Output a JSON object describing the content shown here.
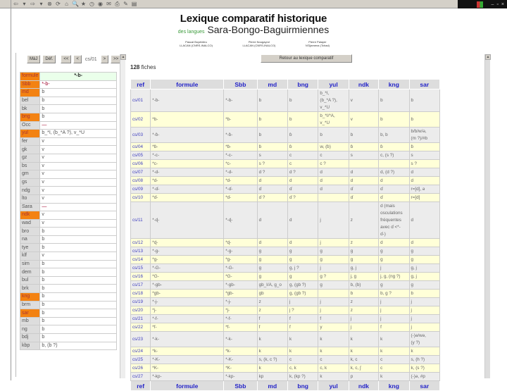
{
  "toolbar": {
    "icons": [
      "back-icon",
      "forward-icon",
      "stop-icon",
      "refresh-icon",
      "home-icon",
      "search-icon",
      "favorites-icon",
      "history-icon",
      "media-icon",
      "mail-icon",
      "print-icon",
      "edit-icon",
      "discuss-icon"
    ],
    "glyphs": [
      "⇦",
      "▾",
      "⇨",
      "▾",
      "⊗",
      "⟳",
      "⌂",
      "🔍",
      "★",
      "◷",
      "◉",
      "✉",
      "⎙",
      "✎",
      "▤"
    ]
  },
  "window": {
    "minimize": "–",
    "restore": "▫",
    "close": "×"
  },
  "header": {
    "title": "Lexique comparatif historique",
    "subtitle_small": "des langues",
    "subtitle": "Sara-Bongo-Baguirmiennes",
    "authors": [
      {
        "name": "Pascal Boyeldieu",
        "affil": "LLACAN (CNRS-INALCO)"
      },
      {
        "name": "Pierre Nougayrol",
        "affil": "LLACAN (CNRS-INALCO)"
      },
      {
        "name": "Pierre Palayer",
        "affil": "N'Djamena (Tchad)"
      }
    ]
  },
  "nav": {
    "maj": "MàJ",
    "def": "Déf.",
    "first": "<<",
    "prev": "<",
    "current": "cs/01",
    "next": ">",
    "last": ">>"
  },
  "detail": [
    {
      "k": "formule",
      "v": "*-b-",
      "hl": true
    },
    {
      "k": "Sbb",
      "v": "*-b-",
      "hl": true
    },
    {
      "k": "md",
      "v": "b",
      "hl": true
    },
    {
      "k": "bel",
      "v": "b"
    },
    {
      "k": "bk",
      "v": "b"
    },
    {
      "k": "bng",
      "v": "b",
      "hl": true
    },
    {
      "k": "Occ",
      "v": "—"
    },
    {
      "k": "yul",
      "v": "b_*I, (b_*A ?), v_*U",
      "hl": true
    },
    {
      "k": "fer",
      "v": "v"
    },
    {
      "k": "gk",
      "v": "v"
    },
    {
      "k": "gz",
      "v": "v"
    },
    {
      "k": "bs",
      "v": "v"
    },
    {
      "k": "gm",
      "v": "v"
    },
    {
      "k": "gs",
      "v": "v"
    },
    {
      "k": "ndg",
      "v": "v"
    },
    {
      "k": "lto",
      "v": "v"
    },
    {
      "k": "Sara",
      "v": "—"
    },
    {
      "k": "ndk",
      "v": "v",
      "hl": true
    },
    {
      "k": "wad",
      "v": "v"
    },
    {
      "k": "bro",
      "v": "b"
    },
    {
      "k": "na",
      "v": "b"
    },
    {
      "k": "tye",
      "v": "b"
    },
    {
      "k": "klf",
      "v": "v"
    },
    {
      "k": "sim",
      "v": "b"
    },
    {
      "k": "dem",
      "v": "b"
    },
    {
      "k": "bul",
      "v": "b"
    },
    {
      "k": "brk",
      "v": "b"
    },
    {
      "k": "kng",
      "v": "b",
      "hl": true
    },
    {
      "k": "brm",
      "v": "b"
    },
    {
      "k": "sar",
      "v": "b",
      "hl": true
    },
    {
      "k": "mb",
      "v": "b"
    },
    {
      "k": "ng",
      "v": "b"
    },
    {
      "k": "bdj",
      "v": "b"
    },
    {
      "k": "kbp",
      "v": "b, (b ?)"
    }
  ],
  "main": {
    "back_button": "Retour au lexique comparatif",
    "count": "128",
    "count_label": " fiches",
    "columns": [
      "ref",
      "formule",
      "Sbb",
      "md",
      "bng",
      "yul",
      "ndk",
      "kng",
      "sar"
    ],
    "rows": [
      [
        "cs/01",
        "*-b-",
        "*-b-",
        "b",
        "b",
        "b_*I,\n(b_*A ?),\nv_*U",
        "v",
        "b",
        "b"
      ],
      [
        "cs/02",
        "*b-",
        "*b-",
        "b",
        "b",
        "b_*I/*A,\nv_*U",
        "v",
        "b",
        "b"
      ],
      [
        "cs/03",
        "*-ɓ-",
        "*-ɓ-",
        "b",
        "ɓ",
        "b",
        "b",
        "b, b",
        "b/b/w/ə,\n(m ?)/#b"
      ],
      [
        "cs/04",
        "*ɓ-",
        "*ɓ-",
        "ɓ",
        "ɓ",
        "w, (ɓ)",
        "ɓ",
        "ɓ",
        "ɓ"
      ],
      [
        "cs/05",
        "*-c-",
        "*-c-",
        "s",
        "c",
        "c",
        "s",
        "c, (s ?)",
        "s"
      ],
      [
        "cs/06",
        "*c-",
        "*c-",
        "s ?",
        "c",
        "c ?",
        "",
        "",
        "s ?"
      ],
      [
        "cs/07",
        "*-d-",
        "*-d-",
        "d ?",
        "d ?",
        "d",
        "d",
        "d, (d ?)",
        "d"
      ],
      [
        "cs/08",
        "*d-",
        "*d-",
        "d",
        "d",
        "d",
        "d",
        "d",
        "d"
      ],
      [
        "cs/09",
        "*-ɗ-",
        "*-ɗ-",
        "ɗ",
        "ɗ",
        "d",
        "ɗ",
        "ɗ",
        "r=[d], ə"
      ],
      [
        "cs/10",
        "*ɗ-",
        "*ɗ-",
        "ɗ ?",
        "ɗ ?",
        "",
        "ɗ",
        "ɗ",
        "r=[d]"
      ],
      [
        "cs/11",
        "*-ɖ-",
        "*-ɖ-",
        "d",
        "d",
        "j",
        "z",
        "d (mais\nosculations\nfréquentes\navec ɗ <*-\nɗ-)",
        "d"
      ],
      [
        "cs/12",
        "*ɖ-",
        "*ɖ-",
        "d",
        "d",
        "j",
        "z",
        "d",
        "d"
      ],
      [
        "cs/13",
        "*-g-",
        "*-g-",
        "g",
        "g",
        "g",
        "g",
        "g",
        "g"
      ],
      [
        "cs/14",
        "*g-",
        "*g-",
        "g",
        "g",
        "g",
        "g",
        "g",
        "g"
      ],
      [
        "cs/15",
        "*-G-",
        "*-G-",
        "g",
        "g, j ?",
        "j",
        "g, j",
        "j",
        "g, j"
      ],
      [
        "cs/16",
        "*G-",
        "*G-",
        "g",
        "g",
        "g ?",
        "j, g",
        "j, g, (ng ?)",
        "g, j"
      ],
      [
        "cs/17",
        "*-gb-",
        "*-gb-",
        "gb_I/A, g_o",
        "g, (gb ?)",
        "g",
        "b, (b)",
        "g",
        "g"
      ],
      [
        "cs/18",
        "*gb-",
        "*gb-",
        "gb",
        "g, (gb ?)",
        "",
        "b",
        "b, g ?",
        "b"
      ],
      [
        "cs/19",
        "*-j-",
        "*-j-",
        "z",
        "j",
        "j",
        "z",
        "j",
        "j"
      ],
      [
        "cs/20",
        "*j-",
        "*j-",
        "z",
        "j ?",
        "j",
        "z",
        "j",
        "j"
      ],
      [
        "cs/21",
        "*-f-",
        "*-f-",
        "f",
        "f",
        "f",
        "j",
        "j",
        "j"
      ],
      [
        "cs/22",
        "*f-",
        "*f-",
        "f",
        "f",
        "y",
        "j",
        "f",
        "j"
      ],
      [
        "cs/23",
        "*-k-",
        "*-k-",
        "k",
        "k",
        "k",
        "k",
        "k",
        "(-)ə/wə,\n(y ?)"
      ],
      [
        "cs/24",
        "*k-",
        "*k-",
        "k",
        "k",
        "k",
        "k",
        "k",
        "k"
      ],
      [
        "cs/25",
        "*-K-",
        "*-K-",
        "s, (k, c ?)",
        "c",
        "c",
        "k, c",
        "c",
        "s, (h ?)"
      ],
      [
        "cs/26",
        "*K-",
        "*K-",
        "k",
        "c, k",
        "c, k",
        "k, c, ʃ",
        "c",
        "k, (s ?)"
      ],
      [
        "cs/27",
        "*-kp-",
        "*-kp-",
        "kp",
        "k, (kp ?)",
        "k",
        "p",
        "k",
        "(-)ə, #p"
      ]
    ]
  }
}
